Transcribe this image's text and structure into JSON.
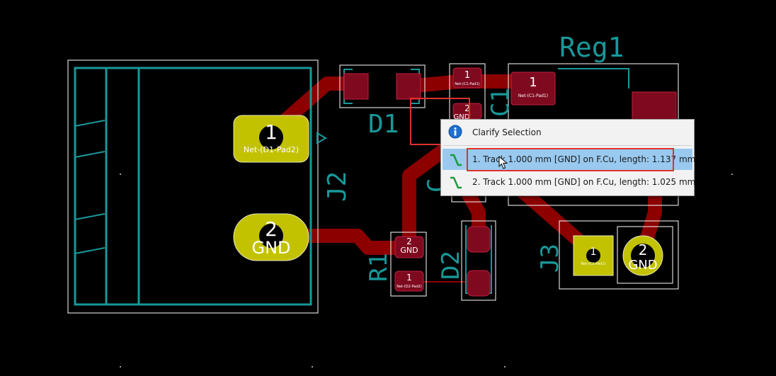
{
  "board": {
    "refs": {
      "reg1": "Reg1",
      "d1": "D1",
      "j2": "J2",
      "c1": "C1",
      "c_lower": "C",
      "d2": "D2",
      "r1": "R1",
      "j3": "J3"
    },
    "pads": {
      "j2_pad1_num": "1",
      "j2_pad1_net": "Net-(D1-Pad2)",
      "j2_pad2_num": "2",
      "j2_pad2_net": "GND",
      "c1_pad1_num": "1",
      "c1_pad1_net": "Net-(C1-Pad1)",
      "c1_pad2_num": "2",
      "c1_pad2_net": "GND",
      "reg1_pad1_num": "1",
      "reg1_pad1_net": "Net-(C1-Pad1)",
      "r1_pad2_num": "2",
      "r1_pad2_net": "GND",
      "r1_pad1_num": "1",
      "r1_pad1_net": "Net-(D2-Pad2)",
      "j3_pad1_num": "1",
      "j3_pad1_net": "Net-(C1-Pad1)",
      "j3_pad2_num": "2",
      "j3_pad2_net": "GND"
    },
    "colors": {
      "background": "#000000",
      "copper_track": "#8c0000",
      "pad_smd": "#7f0a1f",
      "pad_tht": "#c2c200",
      "silkscreen": "#19989a",
      "courtyard": "#ffffff"
    }
  },
  "context_menu": {
    "title": "Clarify Selection",
    "title_icon": "info-icon",
    "items": [
      {
        "label": "1. Track 1.000 mm [GND] on F.Cu, length: 1.137 mm",
        "icon": "track-icon",
        "highlighted": true
      },
      {
        "label": "2. Track 1.000 mm [GND] on F.Cu, length: 1.025 mm",
        "icon": "track-icon",
        "highlighted": false
      }
    ]
  },
  "annotations": {
    "highlight_color": "#e03030"
  }
}
